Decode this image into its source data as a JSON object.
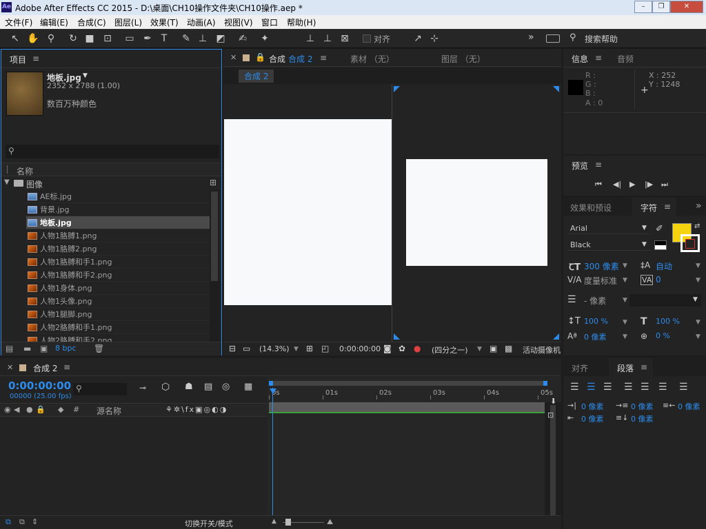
{
  "window": {
    "title": "Adobe After Effects CC 2015 - D:\\桌面\\CH10操作文件夹\\CH10操作.aep *",
    "logo": "Ae"
  },
  "menu": [
    "文件(F)",
    "编辑(E)",
    "合成(C)",
    "图层(L)",
    "效果(T)",
    "动画(A)",
    "视图(V)",
    "窗口",
    "帮助(H)"
  ],
  "toolbar": {
    "align_label": "对齐",
    "search_label": "搜索帮助",
    "expand": "»"
  },
  "project": {
    "tab": "项目",
    "selected_name": "地板.jpg",
    "selected_dims": "2352 x 2788 (1.00)",
    "selected_color": "数百万种颜色",
    "search_placeholder": "",
    "col_name": "名称",
    "folder": "图像",
    "bpc": "8 bpc",
    "items": [
      {
        "name": "AE标.jpg",
        "type": "jpg"
      },
      {
        "name": "背景.jpg",
        "type": "jpg"
      },
      {
        "name": "地板.jpg",
        "type": "jpg",
        "selected": true
      },
      {
        "name": "人物1胳膊1.png",
        "type": "png"
      },
      {
        "name": "人物1胳膊2.png",
        "type": "png"
      },
      {
        "name": "人物1胳膊和手1.png",
        "type": "png"
      },
      {
        "name": "人物1胳膊和手2.png",
        "type": "png"
      },
      {
        "name": "人物1身体.png",
        "type": "png"
      },
      {
        "name": "人物1头像.png",
        "type": "png"
      },
      {
        "name": "人物1腿脚.png",
        "type": "png"
      },
      {
        "name": "人物2胳膊和手1.png",
        "type": "png"
      },
      {
        "name": "人物2胳膊和手2.png",
        "type": "png"
      }
    ]
  },
  "comp": {
    "tab_prefix": "合成",
    "tab_name": "合成 2",
    "footage_tab": "素材 （无）",
    "layer_tab": "图层 （无）",
    "breadcrumb": "合成 2",
    "zoom": "(14.3%)",
    "time": "0:00:00:00",
    "quarter": "(四分之一)",
    "camera": "活动摄像机"
  },
  "info": {
    "tab": "信息",
    "audio_tab": "音频",
    "r": "R :",
    "g": "G :",
    "b": "B :",
    "a": "A : 0",
    "x": "X : 252",
    "y": "Y : 1248"
  },
  "preview": {
    "tab": "预览"
  },
  "effects_tab": "效果和预设",
  "character": {
    "tab": "字符",
    "font": "Arial",
    "style": "Black",
    "size": "300 像素",
    "leading": "自动",
    "kerning": "度量标准",
    "tracking": "0",
    "stroke": "- 像素",
    "vscale": "100 %",
    "hscale": "100 %",
    "baseline": "0 像素",
    "tsume": "0 %",
    "fill_color": "#f5d40f"
  },
  "align_tab": "对齐",
  "para": {
    "tab": "段落",
    "indent_left": "0 像素",
    "indent_first": "0 像素",
    "indent_right": "0 像素",
    "space_before": "0 像素",
    "space_after": "0 像素"
  },
  "timeline": {
    "tab": "合成 2",
    "timecode": "0:00:00:00",
    "fps": "00000 (25.00 fps)",
    "source_col": "源名称",
    "ticks": [
      "0s",
      "01s",
      "02s",
      "03s",
      "04s",
      "05s"
    ],
    "toggle_label": "切换开关/模式"
  }
}
